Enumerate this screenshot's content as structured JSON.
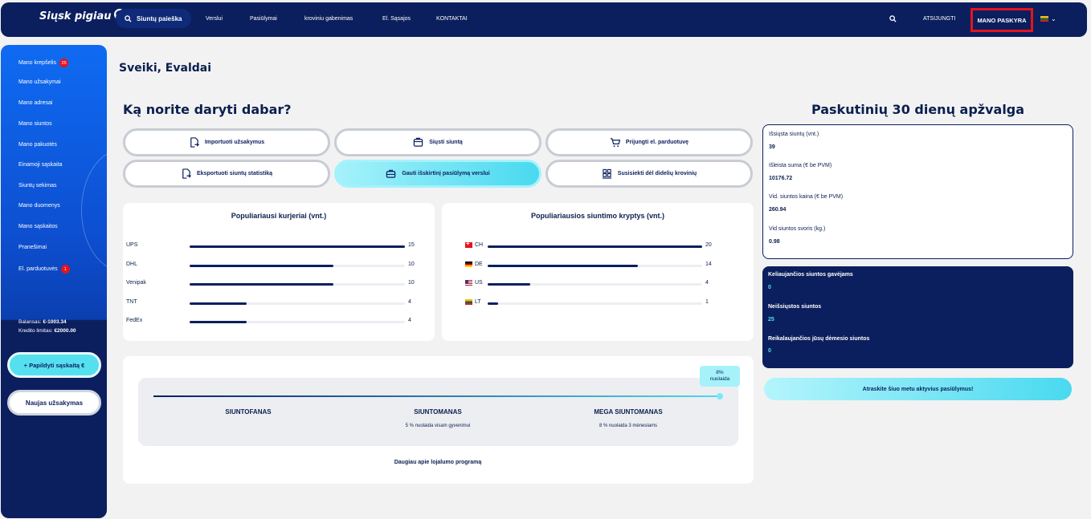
{
  "nav": {
    "logo": "Siųsk pigiau",
    "search_label": "Siuntų paieška",
    "links": [
      "Verslui",
      "Pasiūlymai",
      "kroviniu gabenimas",
      "El. Sąsajos",
      "KONTAKTAI"
    ],
    "logout": "ATSIJUNGTI",
    "account": "MANO PASKYRA",
    "language_icon": "flag-lt-icon"
  },
  "sidebar": {
    "items": [
      {
        "label": "Mano krepšelis",
        "badge": "25"
      },
      {
        "label": "Mano užsakymai"
      },
      {
        "label": "Mano adresai"
      },
      {
        "label": "Mano siuntos"
      },
      {
        "label": "Mano pakuotės"
      },
      {
        "label": "Einamoji sąskaita"
      },
      {
        "label": "Siuntų sekimas"
      },
      {
        "label": "Mano duomenys"
      },
      {
        "label": "Mano sąskaitos"
      },
      {
        "label": "Pranešimai"
      },
      {
        "label": "El. parduotuvės",
        "badge": "1"
      }
    ],
    "balance_label": "Balansas:",
    "balance_value": "€-1003.34",
    "credit_label": "Kredito limitas:",
    "credit_value": "€2000.00",
    "topup_button": "+ Papildyti sąskaitą €",
    "new_order_button": "Naujas užsakymas"
  },
  "main": {
    "greeting": "Sveiki, Evaldai",
    "what_title": "Ką norite daryti dabar?",
    "actions": [
      {
        "label": "Importuoti užsakymus",
        "icon": "import-icon"
      },
      {
        "label": "Siųsti siuntą",
        "icon": "package-icon"
      },
      {
        "label": "Prijungti el. parduotuvę",
        "icon": "cart-icon"
      },
      {
        "label": "Eksportuoti siuntų statistiką",
        "icon": "export-icon"
      },
      {
        "label": "Gauti išskirtinį pasiūlymą verslui",
        "icon": "briefcase-icon"
      },
      {
        "label": "Susisiekti dėl didelių krovinių",
        "icon": "pallet-icon"
      }
    ],
    "couriers": {
      "title": "Populiariausi kurjeriai (vnt.)",
      "items": [
        {
          "label": "UPS",
          "value": 15
        },
        {
          "label": "DHL",
          "value": 10
        },
        {
          "label": "Venipak",
          "value": 10
        },
        {
          "label": "TNT",
          "value": 4
        },
        {
          "label": "FedEx",
          "value": 4
        }
      ]
    },
    "directions": {
      "title": "Populiariausios siuntimo kryptys (vnt.)",
      "items": [
        {
          "label": "CH",
          "flag": "ch",
          "value": 20
        },
        {
          "label": "DE",
          "flag": "de",
          "value": 14
        },
        {
          "label": "US",
          "flag": "us",
          "value": 4
        },
        {
          "label": "LT",
          "flag": "lt",
          "value": 1
        }
      ]
    },
    "loyalty": {
      "tooltip_pct": "8%",
      "tooltip_label": "nuolaida",
      "progress": 1.0,
      "tiers": [
        {
          "name": "SIUNTOFANAS",
          "desc": ""
        },
        {
          "name": "SIUNTOMANAS",
          "desc": "5 % nuolaida visam gyvenimui"
        },
        {
          "name": "MEGA SIUNTOMANAS",
          "desc": "8 % nuolaida 3 mėnesiams"
        }
      ],
      "link": "Daugiau apie lojalumo programą"
    }
  },
  "overview": {
    "title": "Paskutinių 30 dienų apžvalga",
    "stats": [
      {
        "label": "Išsiųsta siuntų (vnt.)",
        "value": "39"
      },
      {
        "label": "Išleista suma (€ be PVM)",
        "value": "10176.72"
      },
      {
        "label": "Vid. siuntos kaina (€ be PVM)",
        "value": "260.94"
      },
      {
        "label": "Vid siuntos svoris (kg.)",
        "value": "0.98"
      }
    ],
    "status": [
      {
        "label": "Keliaujančios siuntos gavėjams",
        "value": "0"
      },
      {
        "label": "Neišsiųstos siuntos",
        "value": "25"
      },
      {
        "label": "Reikalaujančios jūsų dėmesio siuntos",
        "value": "0"
      }
    ],
    "offers_button": "Atraskite šiuo metu aktyvius pasiūlymus!"
  }
}
